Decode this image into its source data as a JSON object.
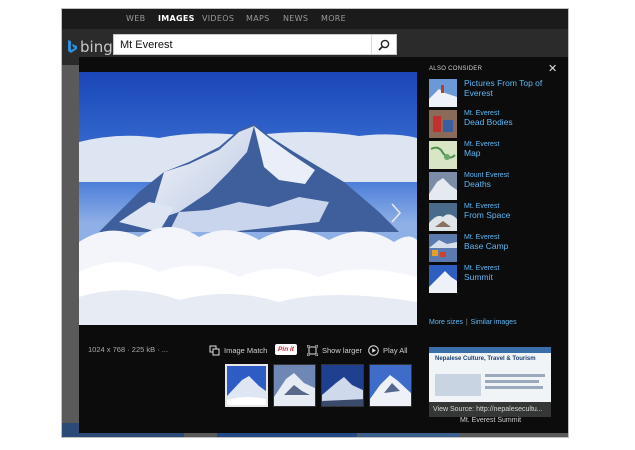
{
  "nav": {
    "items": [
      "WEB",
      "IMAGES",
      "VIDEOS",
      "MAPS",
      "NEWS",
      "MORE"
    ],
    "active": "IMAGES"
  },
  "header": {
    "logo": "bing",
    "search_value": "Mt Everest"
  },
  "viewer": {
    "image_info": "1024 x 768 · 225 kB · ...",
    "actions": {
      "image_match": "Image Match",
      "pinit": "Pin it",
      "show_larger": "Show larger",
      "play_all": "Play All"
    }
  },
  "sidebar": {
    "heading": "ALSO CONSIDER",
    "close": "✕",
    "items": [
      {
        "line1": "",
        "line2": "Pictures From Top of",
        "line3": "Everest"
      },
      {
        "line1": "Mt. Everest",
        "line2": "Dead Bodies",
        "line3": ""
      },
      {
        "line1": "Mt. Everest",
        "line2": "Map",
        "line3": ""
      },
      {
        "line1": "Mount Everest",
        "line2": "Deaths",
        "line3": ""
      },
      {
        "line1": "Mt. Everest",
        "line2": "From Space",
        "line3": ""
      },
      {
        "line1": "Mt. Everest",
        "line2": "Base Camp",
        "line3": ""
      },
      {
        "line1": "Mt. Everest",
        "line2": "Summit",
        "line3": ""
      }
    ],
    "more_sizes": "More sizes",
    "similar_images": "Similar images",
    "source_label": "View Source:",
    "source_url": "http://nepalesecultu...",
    "source_site_title": "Nepalese Culture, Travel & Tourism",
    "source_caption": "Mt. Everest Summit"
  },
  "colors": {
    "accent_link": "#5db8f5",
    "overlay_bg": "#0c0c0c",
    "nav_bg": "#1b1b1b"
  }
}
